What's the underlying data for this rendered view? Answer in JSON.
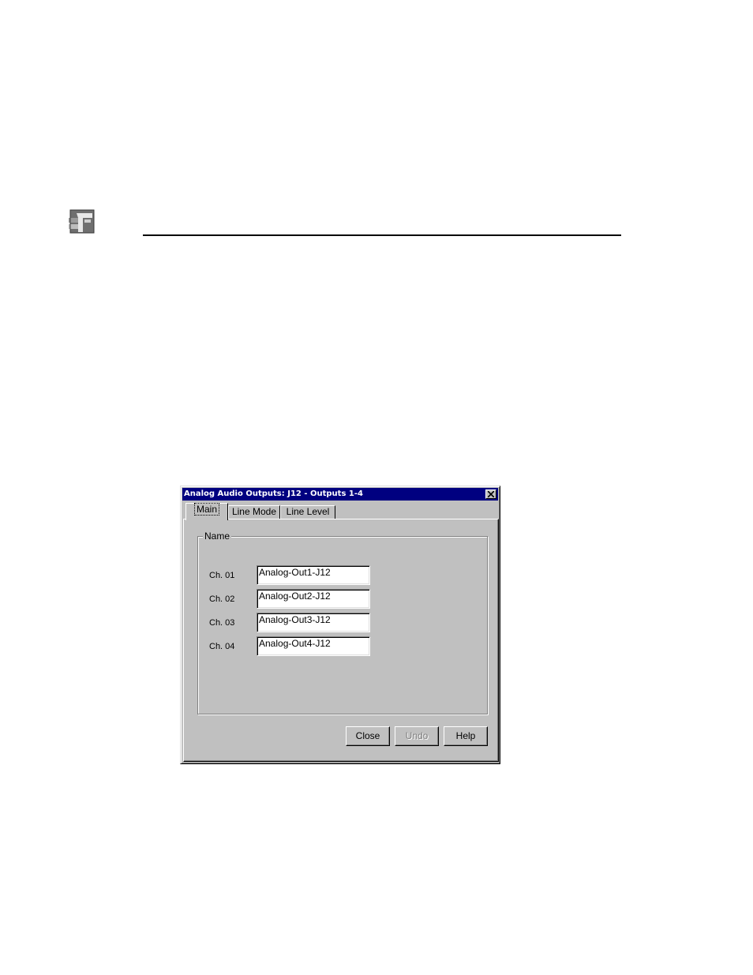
{
  "page": {
    "logo_icon": "company-logo-icon"
  },
  "dialog": {
    "title": "Analog Audio Outputs: J12 - Outputs 1-4",
    "close_icon": "close-icon",
    "tabs": [
      {
        "label": "Main",
        "active": true
      },
      {
        "label": "Line Mode",
        "active": false
      },
      {
        "label": "Line Level",
        "active": false
      }
    ],
    "group_label": "Name",
    "channels": [
      {
        "label": "Ch. 01",
        "value": "Analog-Out1-J12"
      },
      {
        "label": "Ch. 02",
        "value": "Analog-Out2-J12"
      },
      {
        "label": "Ch. 03",
        "value": "Analog-Out3-J12"
      },
      {
        "label": "Ch. 04",
        "value": "Analog-Out4-J12"
      }
    ],
    "buttons": {
      "close": "Close",
      "undo": "Undo",
      "undo_enabled": false,
      "help": "Help"
    },
    "colors": {
      "titlebar": "#000080",
      "face": "#c0c0c0"
    }
  }
}
